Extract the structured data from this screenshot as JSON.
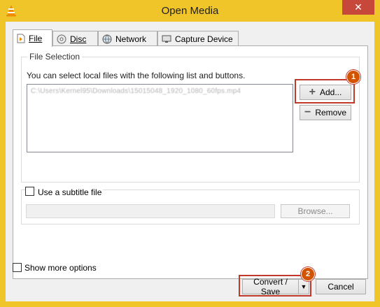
{
  "window": {
    "title": "Open Media",
    "close_glyph": "✕"
  },
  "tabs": [
    {
      "label": "File",
      "icon": "file-icon",
      "active": true
    },
    {
      "label": "Disc",
      "icon": "disc-icon",
      "active": false
    },
    {
      "label": "Network",
      "icon": "network-icon",
      "active": false
    },
    {
      "label": "Capture Device",
      "icon": "capture-device-icon",
      "active": false
    }
  ],
  "file_selection": {
    "legend": "File Selection",
    "description": "You can select local files with the following list and buttons.",
    "files": [
      "C:\\Users\\Kernel95\\Downloads\\15015048_1920_1080_60fps.mp4"
    ],
    "add_button": "Add...",
    "remove_button": "Remove"
  },
  "subtitle": {
    "checkbox_label": "Use a subtitle file",
    "checked": false,
    "browse_button": "Browse..."
  },
  "options": {
    "show_more_label": "Show more options",
    "checked": false
  },
  "footer": {
    "convert_button": "Convert / Save",
    "cancel_button": "Cancel"
  },
  "annotations": {
    "badge_1": "1",
    "badge_2": "2",
    "highlight_color": "#c0392b",
    "badge_color": "#d35400"
  }
}
